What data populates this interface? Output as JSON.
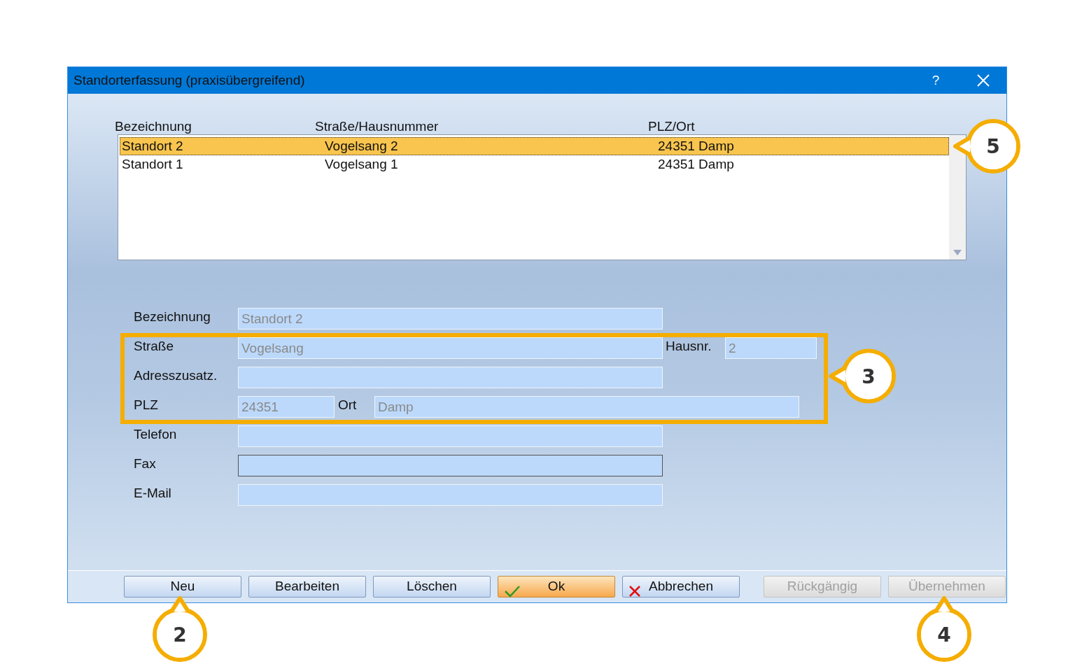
{
  "window": {
    "title": "Standorterfassung (praxisübergreifend)",
    "help": "?"
  },
  "list": {
    "columns": [
      "Bezeichnung",
      "Straße/Hausnummer",
      "PLZ/Ort"
    ],
    "rows": [
      {
        "cells": [
          "Standort 2",
          "Vogelsang 2",
          "24351 Damp"
        ],
        "selected": true
      },
      {
        "cells": [
          "Standort 1",
          "Vogelsang 1",
          "24351 Damp"
        ],
        "selected": false
      }
    ]
  },
  "form": {
    "rows": [
      {
        "kind": "single",
        "fields": [
          {
            "label": "Bezeichnung",
            "value": "Standort 2",
            "disabled": true,
            "focused": false
          }
        ]
      },
      {
        "kind": "pair",
        "fields": [
          {
            "label": "Straße",
            "value": "Vogelsang",
            "disabled": true,
            "focused": false
          },
          {
            "label": "Hausnr.",
            "value": "2",
            "disabled": true,
            "focused": false
          }
        ]
      },
      {
        "kind": "single",
        "fields": [
          {
            "label": "Adresszusatz.",
            "focused": false
          }
        ]
      },
      {
        "kind": "plz",
        "fields": [
          {
            "label": "PLZ",
            "value": "24351",
            "disabled": true,
            "focused": false
          },
          {
            "label": "Ort",
            "value": "Damp",
            "disabled": true,
            "focused": false
          }
        ]
      },
      {
        "kind": "single",
        "fields": [
          {
            "label": "Telefon",
            "focused": false
          }
        ]
      },
      {
        "kind": "single",
        "fields": [
          {
            "label": "Fax",
            "focused": true
          }
        ]
      },
      {
        "kind": "single",
        "fields": [
          {
            "label": "E-Mail",
            "focused": false
          }
        ]
      }
    ]
  },
  "buttons": [
    {
      "label": "Neu",
      "kind": "normal",
      "disabled": false
    },
    {
      "label": "Bearbeiten",
      "kind": "normal",
      "disabled": false
    },
    {
      "label": "Löschen",
      "kind": "normal",
      "disabled": false
    },
    {
      "label": "Ok",
      "kind": "ok",
      "disabled": false
    },
    {
      "label": "Abbrechen",
      "kind": "cancel",
      "disabled": false
    },
    {
      "label": "Rückgängig",
      "kind": "normal",
      "disabled": true
    },
    {
      "label": "Übernehmen",
      "kind": "normal",
      "disabled": true
    }
  ],
  "callouts": [
    {
      "label": "5"
    },
    {
      "label": "3"
    },
    {
      "label": "2"
    },
    {
      "label": "4"
    }
  ]
}
